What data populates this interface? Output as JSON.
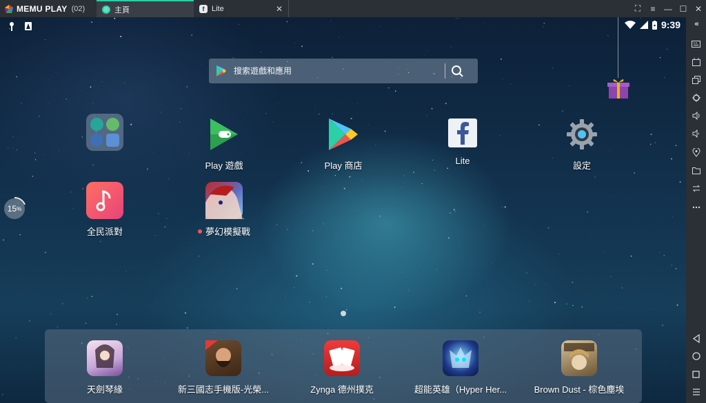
{
  "titlebar": {
    "brand": "MEMU PLAY",
    "instance": "(02)",
    "tabs": [
      {
        "label": "主頁",
        "active": true
      },
      {
        "label": "Lite",
        "active": false,
        "close": "✕"
      }
    ],
    "controls": [
      "⛶",
      "≡",
      "—",
      "☐",
      "✕"
    ]
  },
  "status": {
    "time": "9:39"
  },
  "search": {
    "placeholder": "搜索遊戲和應用"
  },
  "apps": [
    {
      "label": ""
    },
    {
      "label": "Play 遊戲"
    },
    {
      "label": "Play 商店"
    },
    {
      "label": "Lite"
    },
    {
      "label": "設定"
    },
    {
      "label": "全民派對"
    },
    {
      "label": "夢幻模擬戰",
      "new": true
    }
  ],
  "boost": {
    "value": "15",
    "unit": "%"
  },
  "dock": [
    {
      "label": "天劍琴緣"
    },
    {
      "label": "新三國志手機版-光榮..."
    },
    {
      "label": "Zynga 德州撲克"
    },
    {
      "label": "超能英雄（Hyper Her..."
    },
    {
      "label": "Brown Dust - 棕色塵埃"
    }
  ],
  "sidebar": {
    "top": "‹‹‹",
    "items": [
      "keyboard-icon",
      "apk-icon",
      "multi-window-icon",
      "shake-icon",
      "volume-up-icon",
      "volume-down-icon",
      "location-icon",
      "folder-icon",
      "sync-icon",
      "more-icon"
    ],
    "nav": [
      "back-icon",
      "home-icon",
      "recents-icon",
      "menu-icon"
    ]
  },
  "colors": {
    "accent": "#2ad0a6",
    "chrome": "#2b2f36"
  }
}
